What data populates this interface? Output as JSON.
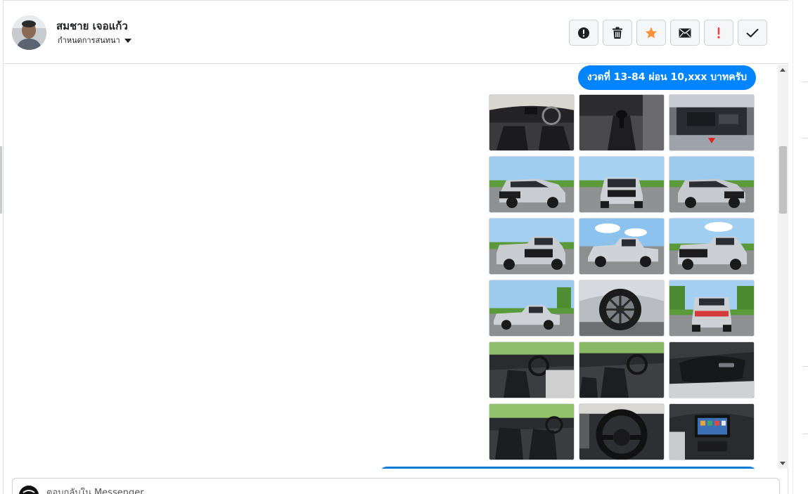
{
  "header": {
    "user_name": "สมชาย เจอแก้ว",
    "assign_label": "กำหนดการสนทนา"
  },
  "toolbar": {
    "buttons": [
      {
        "name": "report-button",
        "icon": "exclamation-circle-icon"
      },
      {
        "name": "delete-button",
        "icon": "trash-icon"
      },
      {
        "name": "star-button",
        "icon": "star-icon",
        "color": "#f7923b"
      },
      {
        "name": "mark-unread-button",
        "icon": "envelope-icon"
      },
      {
        "name": "important-button",
        "icon": "exclamation-icon",
        "color": "#fa383e"
      },
      {
        "name": "done-button",
        "icon": "check-icon"
      }
    ]
  },
  "conversation": {
    "message": "งวดที่ 13-84 ผ่อน 10,xxx บาทครับ",
    "bubble_color": "#0084ff",
    "photos": [
      "interior-dashboard",
      "gear-shifter",
      "engine-bay",
      "front-three-quarter",
      "front",
      "front-three-quarter",
      "rear-three-quarter",
      "side",
      "rear-three-quarter",
      "side",
      "wheel",
      "rear",
      "front-seats",
      "front-seats",
      "door-panel",
      "front-seats",
      "steering-wheel",
      "infotainment"
    ]
  },
  "composer": {
    "placeholder": "ตอบกลับใน Messenger"
  }
}
